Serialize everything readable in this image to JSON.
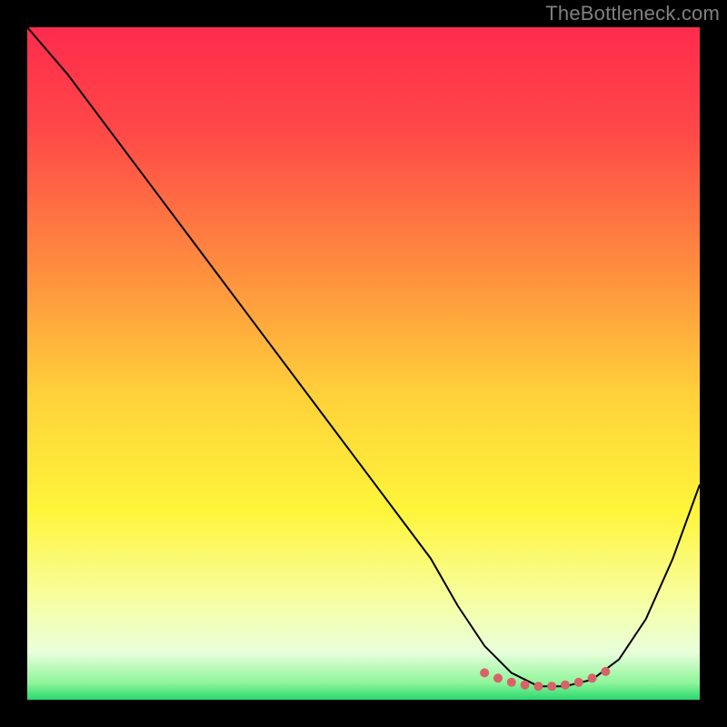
{
  "watermark": "TheBottleneck.com",
  "colors": {
    "curve": "#000000",
    "marker": "#d9626a",
    "page_bg": "#000000"
  },
  "gradient_stops": [
    {
      "offset": 0.0,
      "color": "#ff2b4d"
    },
    {
      "offset": 0.15,
      "color": "#ff4748"
    },
    {
      "offset": 0.35,
      "color": "#ff8a3f"
    },
    {
      "offset": 0.55,
      "color": "#ffd23a"
    },
    {
      "offset": 0.72,
      "color": "#fff53a"
    },
    {
      "offset": 0.86,
      "color": "#f6ffa8"
    },
    {
      "offset": 0.93,
      "color": "#e8ffda"
    },
    {
      "offset": 0.975,
      "color": "#8ef59a"
    },
    {
      "offset": 1.0,
      "color": "#29d86d"
    }
  ],
  "chart_data": {
    "type": "line",
    "title": "",
    "xlabel": "",
    "ylabel": "",
    "xlim": [
      0,
      100
    ],
    "ylim": [
      0,
      100
    ],
    "grid": false,
    "legend": false,
    "series": [
      {
        "name": "bottleneck-curve",
        "x": [
          0,
          6,
          12,
          18,
          24,
          30,
          36,
          42,
          48,
          54,
          60,
          64,
          68,
          72,
          76,
          80,
          84,
          88,
          92,
          96,
          100
        ],
        "y": [
          100,
          93,
          85,
          77,
          69,
          61,
          53,
          45,
          37,
          29,
          21,
          14,
          8,
          4,
          2,
          2,
          3,
          6,
          12,
          21,
          32
        ]
      }
    ],
    "markers": {
      "name": "optimal-range",
      "x": [
        68,
        70,
        72,
        74,
        76,
        78,
        80,
        82,
        84,
        86
      ],
      "y": [
        4,
        3.2,
        2.6,
        2.2,
        2.0,
        2.0,
        2.2,
        2.6,
        3.2,
        4.2
      ]
    }
  }
}
